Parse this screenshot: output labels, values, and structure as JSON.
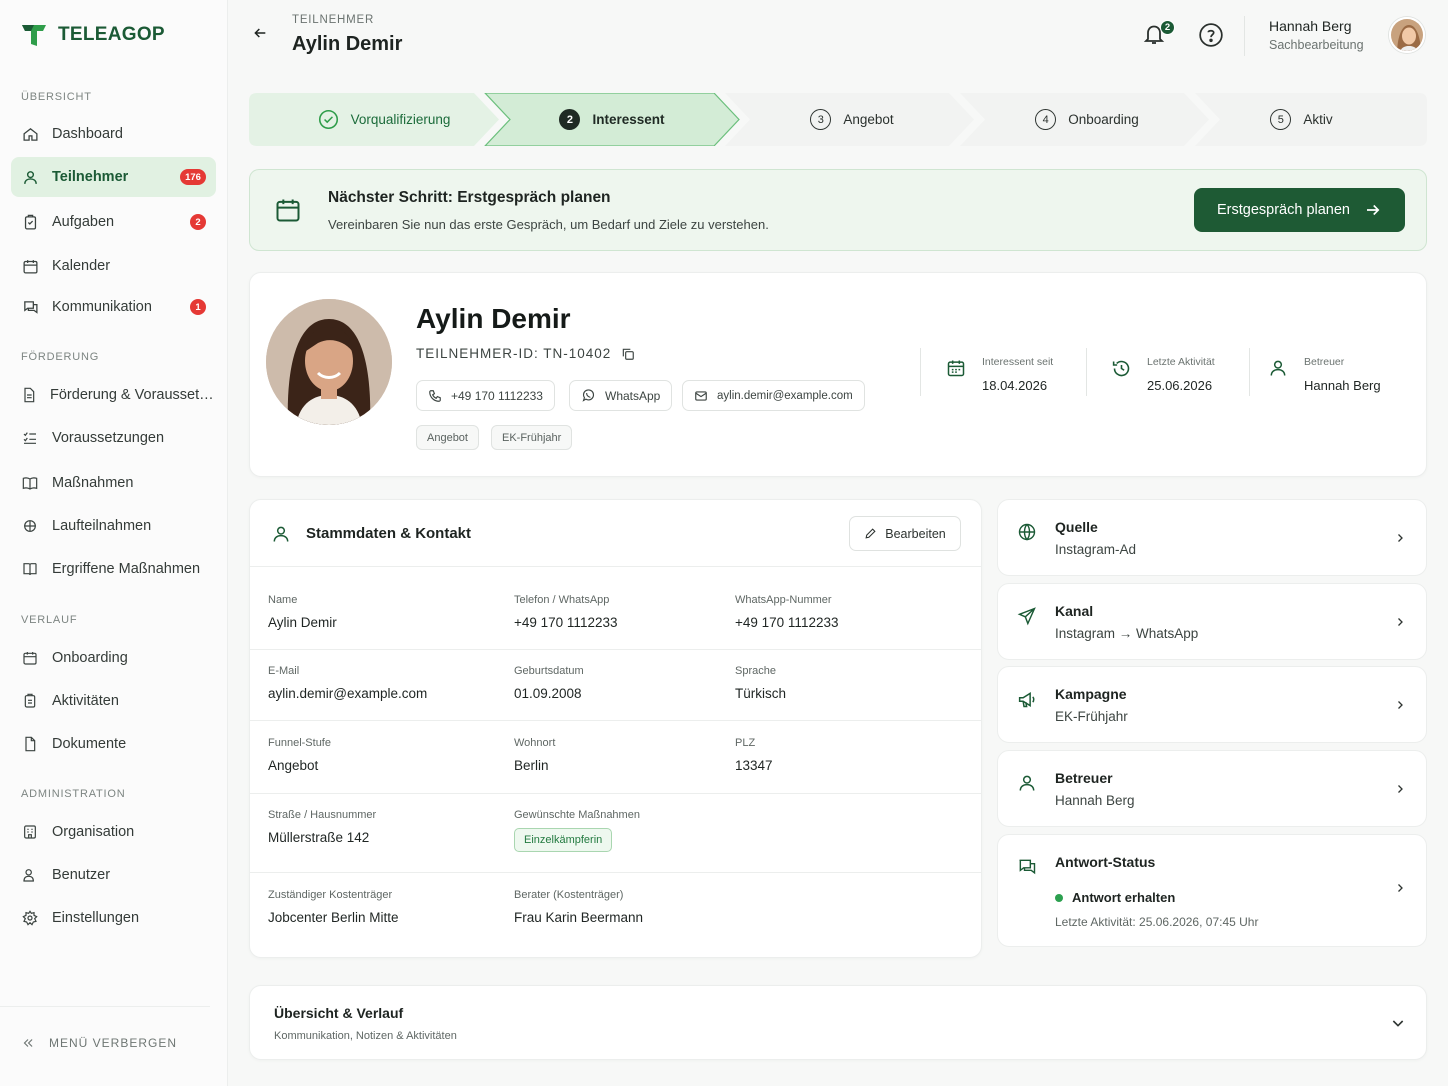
{
  "brand": {
    "name": "TELEAGOP",
    "accent": "#1b5a35",
    "logo_green": "#2f9d4a"
  },
  "sidebar": {
    "sections": [
      {
        "title": "ÜBERSICHT",
        "items": [
          {
            "label": "Dashboard",
            "icon": "home-icon"
          },
          {
            "label": "Teilnehmer",
            "icon": "user-icon",
            "badge": "176",
            "active": true
          },
          {
            "label": "Aufgaben",
            "icon": "clipboard-icon",
            "badge": "2"
          },
          {
            "label": "Kalender",
            "icon": "calendar-icon"
          },
          {
            "label": "Kommunikation",
            "icon": "chat-icon",
            "badge": "1"
          }
        ]
      },
      {
        "title": "FÖRDERUNG",
        "items": [
          {
            "label": "Förderung & Voraussetzungen",
            "icon": "document-icon"
          },
          {
            "label": "Voraussetzungen",
            "icon": "checklist-icon"
          },
          {
            "label": "Maßnahmen",
            "icon": "book-icon"
          },
          {
            "label": "Laufteilnahmen",
            "icon": "puzzle-icon"
          },
          {
            "label": "Ergriffene Maßnahmen",
            "icon": "book-open-icon"
          }
        ]
      },
      {
        "title": "VERLAUF",
        "items": [
          {
            "label": "Onboarding",
            "icon": "calendar-icon"
          },
          {
            "label": "Aktivitäten",
            "icon": "clipboard-icon"
          },
          {
            "label": "Dokumente",
            "icon": "document-icon"
          }
        ]
      },
      {
        "title": "ADMINISTRATION",
        "items": [
          {
            "label": "Organisation",
            "icon": "building-icon"
          },
          {
            "label": "Benutzer",
            "icon": "users-icon"
          },
          {
            "label": "Einstellungen",
            "icon": "gear-icon"
          }
        ]
      }
    ],
    "hide_menu": "MENÜ VERBERGEN"
  },
  "header": {
    "breadcrumb": "TEILNEHMER",
    "title": "Aylin Demir",
    "notifications": "2",
    "user": {
      "name": "Hannah Berg",
      "role": "Sachbearbeitung"
    }
  },
  "stepper": {
    "steps": [
      {
        "label": "Vorqualifizierung",
        "state": "done"
      },
      {
        "num": "2",
        "label": "Interessent",
        "state": "current"
      },
      {
        "num": "3",
        "label": "Angebot",
        "state": "upcoming"
      },
      {
        "num": "4",
        "label": "Onboarding",
        "state": "upcoming"
      },
      {
        "num": "5",
        "label": "Aktiv",
        "state": "upcoming"
      }
    ]
  },
  "next_step": {
    "title": "Nächster Schritt: Erstgespräch planen",
    "subtitle": "Vereinbaren Sie nun das erste Gespräch, um Bedarf und Ziele zu verstehen.",
    "button": "Erstgespräch planen"
  },
  "profile": {
    "name": "Aylin Demir",
    "id_line": "TEILNEHMER-ID: TN-10402",
    "phone": "+49 170 1112233",
    "whatsapp": "WhatsApp",
    "email": "aylin.demir@example.com",
    "tags": [
      "Angebot",
      "EK-Frühjahr"
    ],
    "meta": [
      {
        "label": "Interessent seit",
        "value": "18.04.2026"
      },
      {
        "label": "Letzte Aktivität",
        "value": "25.06.2026"
      },
      {
        "label": "Betreuer",
        "value": "Hannah Berg"
      }
    ]
  },
  "stammdaten": {
    "title": "Stammdaten & Kontakt",
    "edit": "Bearbeiten",
    "fields": {
      "name": {
        "label": "Name",
        "value": "Aylin Demir"
      },
      "telefon": {
        "label": "Telefon / WhatsApp",
        "value": "+49 170 1112233"
      },
      "wa_nummer": {
        "label": "WhatsApp-Nummer",
        "value": "+49 170 1112233"
      },
      "email": {
        "label": "E-Mail",
        "value": "aylin.demir@example.com"
      },
      "geburtsdatum": {
        "label": "Geburtsdatum",
        "value": "01.09.2008"
      },
      "sprache": {
        "label": "Sprache",
        "value": "Türkisch"
      },
      "funnel": {
        "label": "Funnel-Stufe",
        "value": "Angebot"
      },
      "wohnort": {
        "label": "Wohnort",
        "value": "Berlin"
      },
      "plz": {
        "label": "PLZ",
        "value": "13347"
      },
      "strasse": {
        "label": "Straße / Hausnummer",
        "value": "Müllerstraße 142"
      },
      "massnahmen": {
        "label": "Gewünschte Maßnahmen",
        "value": "Einzelkämpferin"
      },
      "kostentraeger": {
        "label": "Zuständiger Kostenträger",
        "value": "Jobcenter Berlin Mitte"
      },
      "berater": {
        "label": "Berater (Kostenträger)",
        "value": "Frau Karin Beermann"
      }
    }
  },
  "side_cards": {
    "quelle": {
      "title": "Quelle",
      "value": "Instagram-Ad"
    },
    "kanal": {
      "title": "Kanal",
      "value": "Instagram → WhatsApp"
    },
    "kampagne": {
      "title": "Kampagne",
      "value": "EK-Frühjahr"
    },
    "betreuer": {
      "title": "Betreuer",
      "value": "Hannah Berg"
    },
    "antwort": {
      "title": "Antwort-Status",
      "status": "Antwort erhalten",
      "last": "Letzte Aktivität:  25.06.2026, 07:45 Uhr"
    }
  },
  "overview": {
    "title": "Übersicht & Verlauf",
    "subtitle": "Kommunikation, Notizen & Aktivitäten"
  }
}
